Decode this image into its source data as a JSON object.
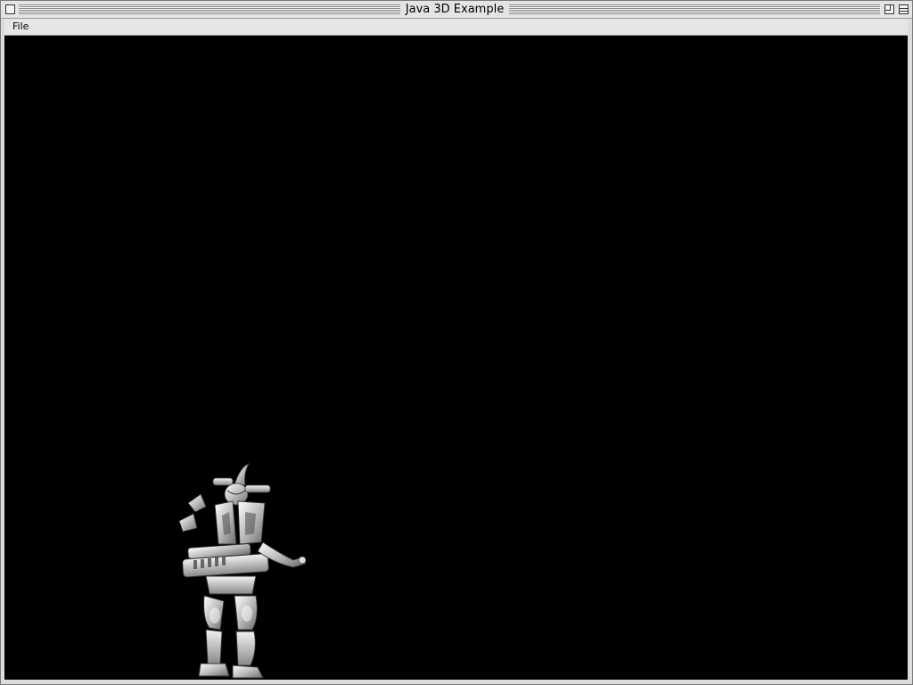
{
  "window": {
    "title": "Java 3D Example"
  },
  "menubar": {
    "items": [
      {
        "label": "File"
      }
    ]
  },
  "canvas": {
    "background": "#000000",
    "model": "robot-figure"
  },
  "icons": {
    "close": "close-box-icon",
    "zoom": "zoom-box-icon",
    "collapse": "windowshade-box-icon"
  }
}
